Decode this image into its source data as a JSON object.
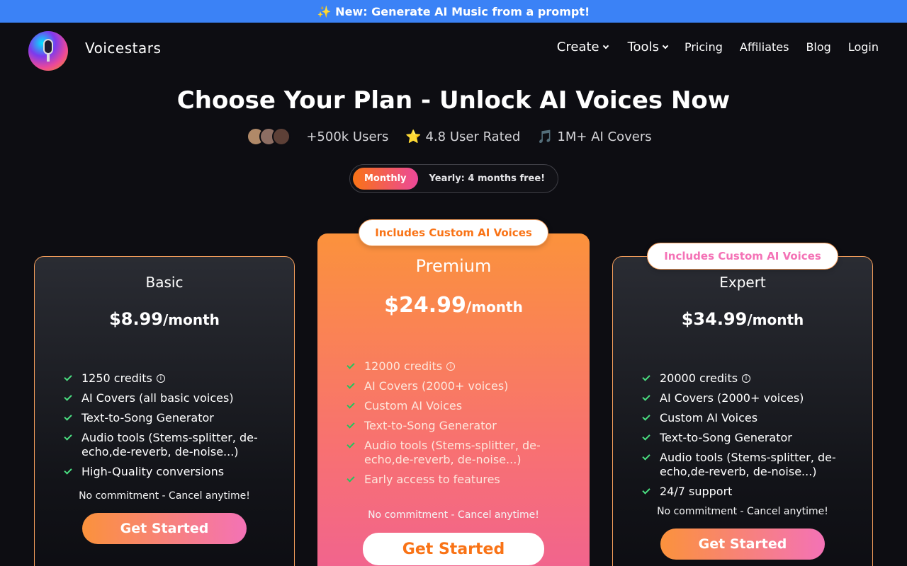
{
  "banner": {
    "text": "✨ New: Generate AI Music from a prompt!"
  },
  "nav": {
    "brand": "Voicestars",
    "links": [
      {
        "label": "Create",
        "dropdown": true
      },
      {
        "label": "Tools",
        "dropdown": true
      },
      {
        "label": "Pricing"
      },
      {
        "label": "Affiliates"
      },
      {
        "label": "Blog"
      },
      {
        "label": "Login"
      }
    ]
  },
  "header": {
    "title": "Choose Your Plan - Unlock AI Voices Now",
    "stats": [
      {
        "icon": "avatars",
        "text": "+500k Users"
      },
      {
        "icon": "star-icon",
        "text": "⭐ 4.8 User Rated"
      },
      {
        "icon": "music-note-icon",
        "text": "🎵 1M+ AI Covers"
      }
    ]
  },
  "billing_toggle": {
    "monthly": "Monthly",
    "yearly": "Yearly: 4 months free!",
    "selected": "Monthly"
  },
  "plans": [
    {
      "name": "Basic",
      "price": "$8.99",
      "period": "/month",
      "features": [
        "1250 credits",
        "AI Covers (all basic voices)",
        "Text-to-Song Generator",
        "Audio tools (Stems-splitter, de-echo,de-reverb, de-noise...)",
        "High-Quality conversions"
      ],
      "note": "No commitment - Cancel anytime!",
      "cta": "Get Started"
    },
    {
      "name": "Premium",
      "badge": "Includes Custom AI Voices",
      "price": "$24.99",
      "period": "/month",
      "features": [
        "12000 credits",
        "AI Covers (2000+ voices)",
        "Custom AI Voices",
        "Text-to-Song Generator",
        "Audio tools (Stems-splitter, de-echo,de-reverb, de-noise...)",
        "Early access to features"
      ],
      "note": "No commitment - Cancel anytime!",
      "cta": "Get Started"
    },
    {
      "name": "Expert",
      "badge": "Includes Custom AI Voices",
      "price": "$34.99",
      "period": "/month",
      "features": [
        "20000 credits",
        "AI Covers (2000+ voices)",
        "Custom AI Voices",
        "Text-to-Song Generator",
        "Audio tools (Stems-splitter, de-echo,de-reverb, de-noise...)",
        "24/7 support"
      ],
      "note": "No commitment - Cancel anytime!",
      "cta": "Get Started"
    }
  ],
  "colors": {
    "banner": "#3b82f6",
    "accent_orange": "#fb923c",
    "accent_pink": "#f472b6",
    "check_green": "#4ade80",
    "background": "#0d0d12"
  }
}
